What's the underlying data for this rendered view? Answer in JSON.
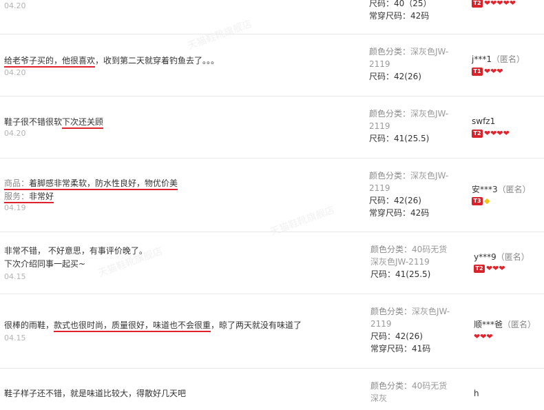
{
  "rows": [
    {
      "date": "04.20",
      "meta": {
        "size": "尺码：40（25）",
        "usual": "常穿尺码：42码"
      }
    },
    {
      "comment_u": "给老爷子买的，他很喜欢",
      "comment_rest": "，收到第二天就穿着钓鱼去了。。。",
      "date": "04.20",
      "meta": {
        "color_label": "颜色分类：",
        "color_value": "深灰色JW-2119",
        "size": "尺码：42(26)"
      },
      "user": "j***1",
      "anon": "（匿名）",
      "level": "T1",
      "hearts": 3
    },
    {
      "comment_a": "鞋子很不错很软",
      "comment_u": "下次还关顾",
      "date": "04.20",
      "meta": {
        "color_label": "颜色分类：",
        "color_value": "深灰色JW-2119",
        "size": "尺码：41(25.5)"
      },
      "user": "swfz1",
      "level": "T2",
      "hearts": 4
    },
    {
      "prod_label": "商品：",
      "prod_text": "着脚感非常柔软，防水性良好，物优价美",
      "svc_label": "服务：",
      "svc_text": "非常好",
      "date": "04.19",
      "meta": {
        "color_label": "颜色分类：",
        "color_value": "深灰色JW-2119",
        "size": "尺码：42(26)",
        "usual": "常穿尺码：42码"
      },
      "user": "安***3",
      "anon": "（匿名）",
      "level": "T3",
      "hearts": 1
    },
    {
      "line1": "非常不错， 不好意思，有事评价晚了。",
      "line2": "下次介绍同事一起买~",
      "date": "04.15",
      "meta": {
        "color_label": "颜色分类：",
        "color_value": "40码无货深灰色JW-2119",
        "size": "尺码：41(25.5)"
      },
      "user": "y***9",
      "anon": "（匿名）",
      "level": "T2",
      "hearts": 3
    },
    {
      "comment_a": "很棒的雨鞋，",
      "comment_u": "款式也很时尚，质量很好，味道也不会很重",
      "comment_rest": "，晾了两天就没有味道了",
      "date": "04.15",
      "meta": {
        "color_label": "颜色分类：",
        "color_value": "深灰色JW-2119",
        "size": "尺码：42(26)",
        "usual": "常穿尺码：41码"
      },
      "user": "顺***爸",
      "anon": "（匿名）",
      "hearts": 3
    },
    {
      "comment_a": "鞋子样子还不错，就是味道比较大，得散好几天吧",
      "meta": {
        "color_label": "颜色分类：",
        "color_value": "40码无货深灰"
      },
      "user": "h"
    }
  ],
  "watermark": "天猫鞋靴旗舰店"
}
